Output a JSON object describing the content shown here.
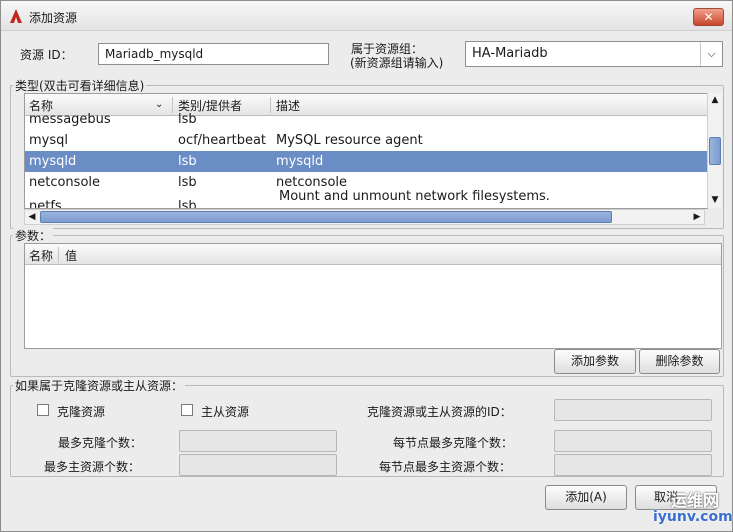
{
  "window": {
    "title": "添加资源",
    "close_label": "✕"
  },
  "form": {
    "resource_id_label": "资源 ID：",
    "resource_id_value": "Mariadb_mysqld",
    "group_label_line1": "属于资源组：",
    "group_label_line2": "(新资源组请输入)",
    "group_value": "HA-Mariadb"
  },
  "type_section": {
    "title": "类型(双击可看详细信息)",
    "columns": [
      "名称",
      "类别/提供者",
      "描述"
    ],
    "rows": [
      {
        "name": "messagebus",
        "provider": "lsb",
        "desc": ""
      },
      {
        "name": "mysql",
        "provider": "ocf/heartbeat",
        "desc": "MySQL resource agent"
      },
      {
        "name": "mysqld",
        "provider": "lsb",
        "desc": "mysqld",
        "selected": true
      },
      {
        "name": "netconsole",
        "provider": "lsb",
        "desc": "netconsole"
      },
      {
        "name": "netfs",
        "provider": "lsb",
        "desc": "Mount and unmount network filesystems."
      }
    ]
  },
  "params_section": {
    "title": "参数：",
    "columns": [
      "名称",
      "值"
    ],
    "add_button": "添加参数",
    "delete_button": "删除参数"
  },
  "clone_section": {
    "title": "如果属于克隆资源或主从资源：",
    "clone_checkbox": "克隆资源",
    "master_checkbox": "主从资源",
    "clone_master_id_label": "克隆资源或主从资源的ID：",
    "max_clones_label": "最多克隆个数：",
    "max_masters_label": "最多主资源个数：",
    "max_clones_per_node_label": "每节点最多克隆个数：",
    "max_masters_per_node_label": "每节点最多主资源个数："
  },
  "footer": {
    "add_button": "添加(A)",
    "cancel_button": "取消"
  },
  "watermark": {
    "cn": "运维网",
    "en": "iyunv.com"
  }
}
